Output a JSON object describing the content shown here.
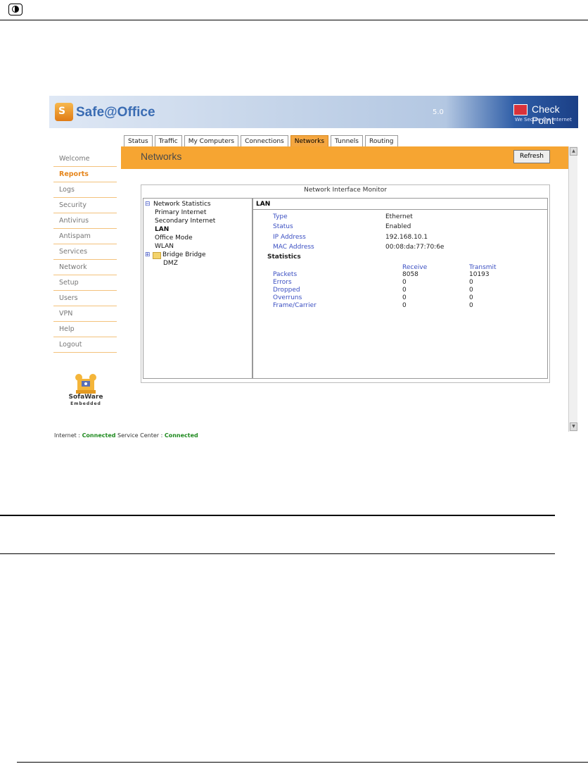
{
  "app": {
    "title": "Safe@Office",
    "logo_letter": "S",
    "version": "5.0",
    "vendor": "Check Point",
    "vendor_tagline": "We Secure the Internet"
  },
  "tabs": [
    {
      "label": "Status",
      "active": false
    },
    {
      "label": "Traffic",
      "active": false
    },
    {
      "label": "My Computers",
      "active": false
    },
    {
      "label": "Connections",
      "active": false
    },
    {
      "label": "Networks",
      "active": true
    },
    {
      "label": "Tunnels",
      "active": false
    },
    {
      "label": "Routing",
      "active": false
    }
  ],
  "section": {
    "title": "Networks",
    "refresh_label": "Refresh"
  },
  "sidebar": {
    "items": [
      {
        "label": "Welcome",
        "active": false
      },
      {
        "label": "Reports",
        "active": true
      },
      {
        "label": "Logs",
        "active": false
      },
      {
        "label": "Security",
        "active": false
      },
      {
        "label": "Antivirus",
        "active": false
      },
      {
        "label": "Antispam",
        "active": false
      },
      {
        "label": "Services",
        "active": false
      },
      {
        "label": "Network",
        "active": false
      },
      {
        "label": "Setup",
        "active": false
      },
      {
        "label": "Users",
        "active": false
      },
      {
        "label": "VPN",
        "active": false
      },
      {
        "label": "Help",
        "active": false
      },
      {
        "label": "Logout",
        "active": false
      }
    ],
    "brand_name": "SofaWare",
    "brand_sub": "Embedded"
  },
  "monitor": {
    "title": "Network Interface Monitor",
    "tree": [
      "Network Statistics",
      "Primary Internet",
      "Secondary Internet",
      "LAN",
      "Office Mode",
      "WLAN",
      "Bridge Bridge",
      "DMZ"
    ],
    "detail": {
      "title": "LAN",
      "properties": [
        {
          "label": "Type",
          "value": "Ethernet"
        },
        {
          "label": "Status",
          "value": "Enabled"
        },
        {
          "label": "IP Address",
          "value": "192.168.10.1"
        },
        {
          "label": "MAC Address",
          "value": "00:08:da:77:70:6e"
        }
      ],
      "statistics_label": "Statistics",
      "receive_header": "Receive",
      "transmit_header": "Transmit",
      "stats": [
        {
          "label": "Packets",
          "receive": "8058",
          "transmit": "10193"
        },
        {
          "label": "Errors",
          "receive": "0",
          "transmit": "0"
        },
        {
          "label": "Dropped",
          "receive": "0",
          "transmit": "0"
        },
        {
          "label": "Overruns",
          "receive": "0",
          "transmit": "0"
        },
        {
          "label": "Frame/Carrier",
          "receive": "0",
          "transmit": "0"
        }
      ]
    }
  },
  "status_line": {
    "internet_label": "Internet :",
    "internet_value": "Connected",
    "service_label": "Service Center :",
    "service_value": "Connected"
  },
  "colors": {
    "accent_orange": "#f6a532",
    "link_blue": "#3b4fc2",
    "ok_green": "#1f8a1f"
  }
}
